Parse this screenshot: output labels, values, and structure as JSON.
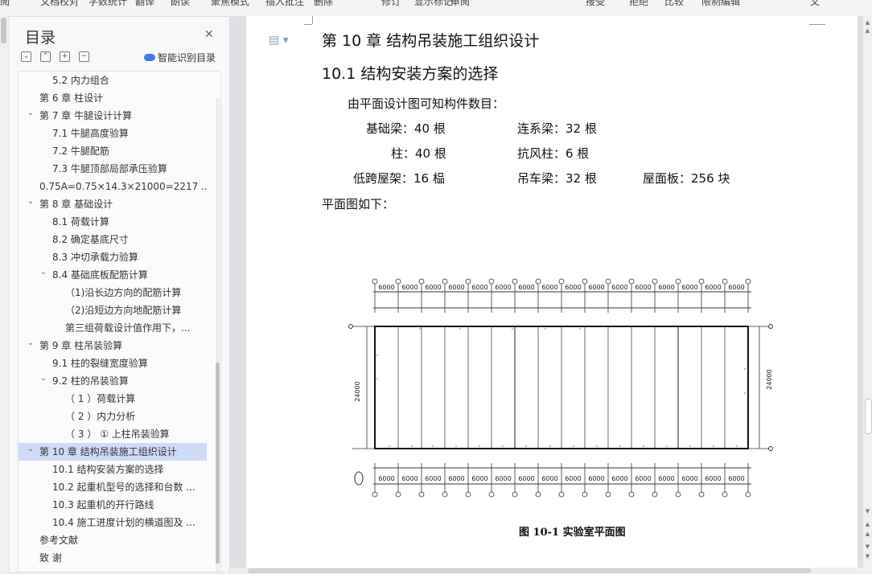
{
  "toolbar": {
    "items": [
      "阅",
      "文档校对",
      "字数统计",
      "翻译",
      "朗读",
      "聚焦模式",
      "插入批注",
      "删除",
      "修订",
      "显示标记",
      "审阅",
      "接受",
      "拒绝",
      "比较",
      "限制编辑",
      "文"
    ]
  },
  "outline": {
    "title": "目录",
    "smart_label": "智能识别目录",
    "items": [
      {
        "label": "5.2  内力组合",
        "level": 2,
        "chevron": false,
        "selected": false
      },
      {
        "label": "第 6 章    柱设计",
        "level": 1,
        "chevron": false,
        "selected": false
      },
      {
        "label": "第 7 章    牛腿设计计算",
        "level": 1,
        "chevron": true,
        "selected": false
      },
      {
        "label": "7.1  牛腿高度验算",
        "level": 2,
        "chevron": false,
        "selected": false
      },
      {
        "label": "7.2  牛腿配筋",
        "level": 2,
        "chevron": false,
        "selected": false
      },
      {
        "label": "7.3  牛腿顶部局部承压验算",
        "level": 2,
        "chevron": false,
        "selected": false
      },
      {
        "label": "0.75A=0.75×14.3×21000=2217 ...",
        "level": 1,
        "chevron": false,
        "selected": false
      },
      {
        "label": "第 8 章    基础设计",
        "level": 1,
        "chevron": true,
        "selected": false
      },
      {
        "label": "8.1  荷载计算",
        "level": 2,
        "chevron": false,
        "selected": false
      },
      {
        "label": "8.2  确定基底尺寸",
        "level": 2,
        "chevron": false,
        "selected": false
      },
      {
        "label": "8.3  冲切承载力验算",
        "level": 2,
        "chevron": false,
        "selected": false
      },
      {
        "label": "8.4  基础底板配筋计算",
        "level": 2,
        "chevron": true,
        "selected": false
      },
      {
        "label": "（1)沿长边方向的配筋计算",
        "level": 3,
        "chevron": false,
        "selected": false
      },
      {
        "label": "（2)沿短边方向地配筋计算",
        "level": 3,
        "chevron": false,
        "selected": false
      },
      {
        "label": "第三组荷载设计值作用下，...",
        "level": 3,
        "chevron": false,
        "selected": false
      },
      {
        "label": "第 9 章    柱吊装验算",
        "level": 1,
        "chevron": true,
        "selected": false
      },
      {
        "label": "9.1  柱的裂缝宽度验算",
        "level": 2,
        "chevron": false,
        "selected": false
      },
      {
        "label": "9.2  柱的吊装验算",
        "level": 2,
        "chevron": true,
        "selected": false
      },
      {
        "label": "（ 1 ）荷载计算",
        "level": 3,
        "chevron": false,
        "selected": false
      },
      {
        "label": "（ 2 ）内力分析",
        "level": 3,
        "chevron": false,
        "selected": false
      },
      {
        "label": "（ 3 ） ①  上柱吊装验算",
        "level": 3,
        "chevron": false,
        "selected": false
      },
      {
        "label": "第 10 章    结构吊装施工组织设计",
        "level": 1,
        "chevron": true,
        "selected": true
      },
      {
        "label": "10.1  结构安装方案的选择",
        "level": 2,
        "chevron": false,
        "selected": false
      },
      {
        "label": "10.2  起重机型号的选择和台数 ...",
        "level": 2,
        "chevron": false,
        "selected": false
      },
      {
        "label": "10.3  起重机的开行路线",
        "level": 2,
        "chevron": false,
        "selected": false
      },
      {
        "label": "10.4  施工进度计划的横道图及 ...",
        "level": 2,
        "chevron": false,
        "selected": false
      },
      {
        "label": "参考文献",
        "level": 1,
        "chevron": false,
        "selected": false
      },
      {
        "label": "致    谢",
        "level": 1,
        "chevron": false,
        "selected": false
      }
    ]
  },
  "document": {
    "chapter_heading": "第 10 章    结构吊装施工组织设计",
    "section_heading": "10.1  结构安装方案的选择",
    "intro": "由平面设计图可知构件数目：",
    "counts": [
      {
        "label": "基础梁：40 根"
      },
      {
        "label": "连系梁：32 根"
      },
      {
        "label": "柱：40 根"
      },
      {
        "label": "抗风柱：6 根"
      },
      {
        "label": "低跨屋架：16 榀"
      },
      {
        "label": "吊车梁：32 根"
      },
      {
        "label": "屋面板：256 块"
      }
    ],
    "plan_intro": "平面图如下：",
    "figure": {
      "caption": "图 10-1 实验室平面图",
      "bay_labels": [
        "6000",
        "6000",
        "6000",
        "6000",
        "6000",
        "6000",
        "6000",
        "6000",
        "6000",
        "6000",
        "6000",
        "6000",
        "6000",
        "6000",
        "6000",
        "6000"
      ],
      "span_label": "24000"
    }
  },
  "colors": {
    "selection": "#cfdcf7",
    "panel_bg": "#f7f8f9",
    "accent": "#3d7de9"
  }
}
